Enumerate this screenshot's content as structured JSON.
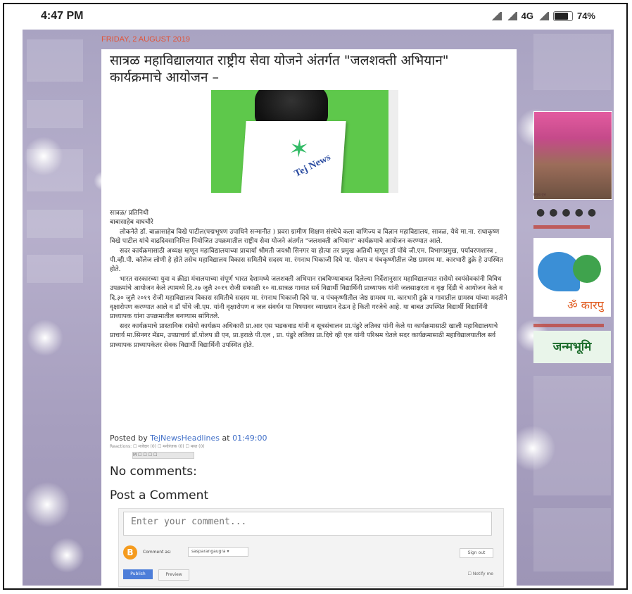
{
  "statusbar": {
    "time": "4:47 PM",
    "network": "4G",
    "battery": "74%"
  },
  "post": {
    "date": "FRIDAY, 2 AUGUST 2019",
    "title": "सात्रळ महाविद्यालयात राष्ट्रीय सेवा योजने अंतर्गत \"जलशक्ती अभियान\" कार्यक्रमाचे आयोजन –",
    "image_logo": "Tej News",
    "byline1": "सात्रळ/ प्रतिनिधी",
    "byline2": "बाबासाहेब वाघचौरे",
    "para1": "लोकनेते डॉ. बाळासाहेब विखे पाटील(पद्मभूषण उपाधिने सन्मानीत ) प्रवरा ग्रामीण शिक्षण संस्थेचे कला वाणिज्य व विज्ञान महाविद्यालय, सात्रळ, येथे मा.ना. राधाकृष्ण विखे पाटील यांचे वाढदिवसानिमित्त नियोजित उपक्रमातील राष्ट्रीय सेवा योजने अंतर्गत \"जलशक्ती अभियान\" कार्यक्रमाचे आयोजन करण्यात आले.",
    "para2": "सदर कार्यक्रमासाठी अध्यक्ष म्हणून महाविद्यालयाच्या प्राचार्या श्रीमती जयश्री सिनगर या होत्या तर प्रमुख अतिथी म्हणून डॉ पोंधे जी.एम. विभागप्रमुख, पर्यावरणशास्त्र , पी.व्ही.पी. कॉलेज लोणी हे होते तसेच महाविद्यालय विकास समितीचे सदस्य मा. रंगनाथ भिकाजी दिघे पा. पोलप व पंचकृष्णीतील जेष्ठ ग्रामस्थ मा. कारभारी डुक्रे हे उपस्थित होते.",
    "para3": "भारत सरकारच्या युवा व क्रीडा मंत्रालयाच्या संपूर्ण भारत देशामध्ये जलशक्ती अभियान राबविण्याबाबत दिलेल्या निर्देशानुसार महाविद्यालयात रासेयो स्वयंसेवकांनी विविध उपक्रमांचे आयोजन केले त्यामध्ये दि.२७ जुलै २०१९ रोजी सकाळी १० वा.सात्रळ गावात सर्व विद्यार्थी विद्यार्थिनी प्राध्यापक यांनी जलसाक्षरता व वृक्ष दिंडी चे आयोजन केले व दि.३० जुलै २०१९ रोजी महाविद्यालय विकास समितीचे सदस्य मा. रंगनाथ भिकाजी दिघे पा. व पंचकृष्णीतील जेष्ठ ग्रामस्थ मा. कारभारी डुक्रे व गावातील ग्रामस्थ यांच्या मदतीने वृक्षारोपण करण्यात आले व डॉ पोंधे जी.एम. यांनी वृक्षारोपण व जल संवर्धन या विषयावर व्याख्यान देऊन हे किती गरजेचे आहे. या बाबत उपस्थित विद्यार्थी विद्यार्थिनी प्राध्यापक यांना उपक्रमातील बनण्यास सांगितले.",
    "para4": "सदर कार्यक्रमाचे प्रास्ताविक रासेयो कार्यक्रम अधिकारी प्रा.आर एस भडकवाड यांनी व सूत्रसंचालन प्रा.पंढुरे लतिका यांनी केले या कार्यक्रमासाठी खाली महाविद्यालयाचे प्राचार्य मा.सिनगर मॅडम, उपप्राचार्य डॉ.पोलप डी एन, प्रा.हराळे पी.एल , प्रा. पंढुरे लतिका प्रा.दिघे व्ही एल यांनी परिश्रम घेतले सदर कार्यक्रमासाठी महाविद्यालयातील सर्व प्राध्यापक प्राध्यापकेतर सेवक विद्यार्थी विद्यार्थिनी उपस्थित होते.",
    "posted_prefix": "Posted by",
    "author": "TejNewsHeadlines",
    "posted_at": "at",
    "time": "01:49:00",
    "reactions": "Reactions: ☐ मजेदार (0) ☐ मनोरंजक (0) ☐ मस्त (0)",
    "share": "M ☐ ☐ ☐ ☐"
  },
  "comments": {
    "no_comments": "No comments:",
    "post_a_comment": "Post a Comment",
    "placeholder": "Enter your comment...",
    "comment_as": "Comment as:",
    "account": "sasparangaugra ▾",
    "sign_out": "Sign out",
    "publish": "Publish",
    "preview": "Preview",
    "notify": "☐ Notify me"
  },
  "sidebar_right": {
    "photo_caption": "प्रमुख वृत्त",
    "charity_text": "ॐ कारपु",
    "janmabhoomi": "जन्मभूमि"
  }
}
